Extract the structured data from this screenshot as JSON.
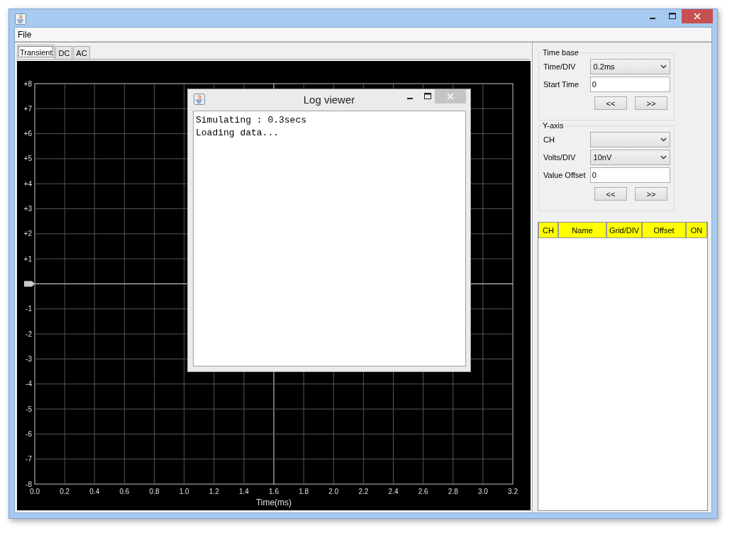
{
  "menu": [
    {
      "label": "File"
    }
  ],
  "tabs": [
    {
      "label": "Transient",
      "selected": true
    },
    {
      "label": "DC",
      "selected": false
    },
    {
      "label": "AC",
      "selected": false
    }
  ],
  "plot": {
    "y_ticks": [
      {
        "kind": "label",
        "label": "+8"
      },
      {
        "kind": "label",
        "label": "+7"
      },
      {
        "kind": "label",
        "label": "+6"
      },
      {
        "kind": "label",
        "label": "+5"
      },
      {
        "kind": "label",
        "label": "+4"
      },
      {
        "kind": "label",
        "label": "+3"
      },
      {
        "kind": "label",
        "label": "+2"
      },
      {
        "kind": "label",
        "label": "+1"
      },
      {
        "kind": "marker"
      },
      {
        "kind": "label",
        "label": "-1"
      },
      {
        "kind": "label",
        "label": "-2"
      },
      {
        "kind": "label",
        "label": "-3"
      },
      {
        "kind": "label",
        "label": "-4"
      },
      {
        "kind": "label",
        "label": "-5"
      },
      {
        "kind": "label",
        "label": "-6"
      },
      {
        "kind": "label",
        "label": "-7"
      },
      {
        "kind": "label",
        "label": "-8"
      }
    ],
    "x_ticks": [
      "0.0",
      "0.2",
      "0.4",
      "0.6",
      "0.8",
      "1.0",
      "1.2",
      "1.4",
      "1.6",
      "1.8",
      "2.0",
      "2.2",
      "2.4",
      "2.6",
      "2.8",
      "3.0",
      "3.2"
    ],
    "xlabel": "Time(ms)"
  },
  "log_viewer": {
    "title": "Log viewer",
    "lines": [
      "Simulating : 0.3secs",
      "Loading data..."
    ]
  },
  "time_base": {
    "title": "Time base",
    "fields": [
      {
        "label": "Time/DIV",
        "kind": "select",
        "value": "0.2ms"
      },
      {
        "label": "Start Time",
        "kind": "input",
        "value": "0"
      }
    ],
    "buttons": [
      "<<",
      ">>"
    ]
  },
  "y_axis": {
    "title": "Y-axis",
    "fields": [
      {
        "label": "CH",
        "kind": "select"
      },
      {
        "label": "Volts/DIV",
        "kind": "select",
        "value": "10nV"
      },
      {
        "label": "Value Offset",
        "kind": "input",
        "value": "0"
      }
    ],
    "buttons": [
      "<<",
      ">>"
    ]
  },
  "channel_table": {
    "columns": [
      "CH",
      "Name",
      "Grid/DIV",
      "Offset",
      "ON"
    ]
  }
}
